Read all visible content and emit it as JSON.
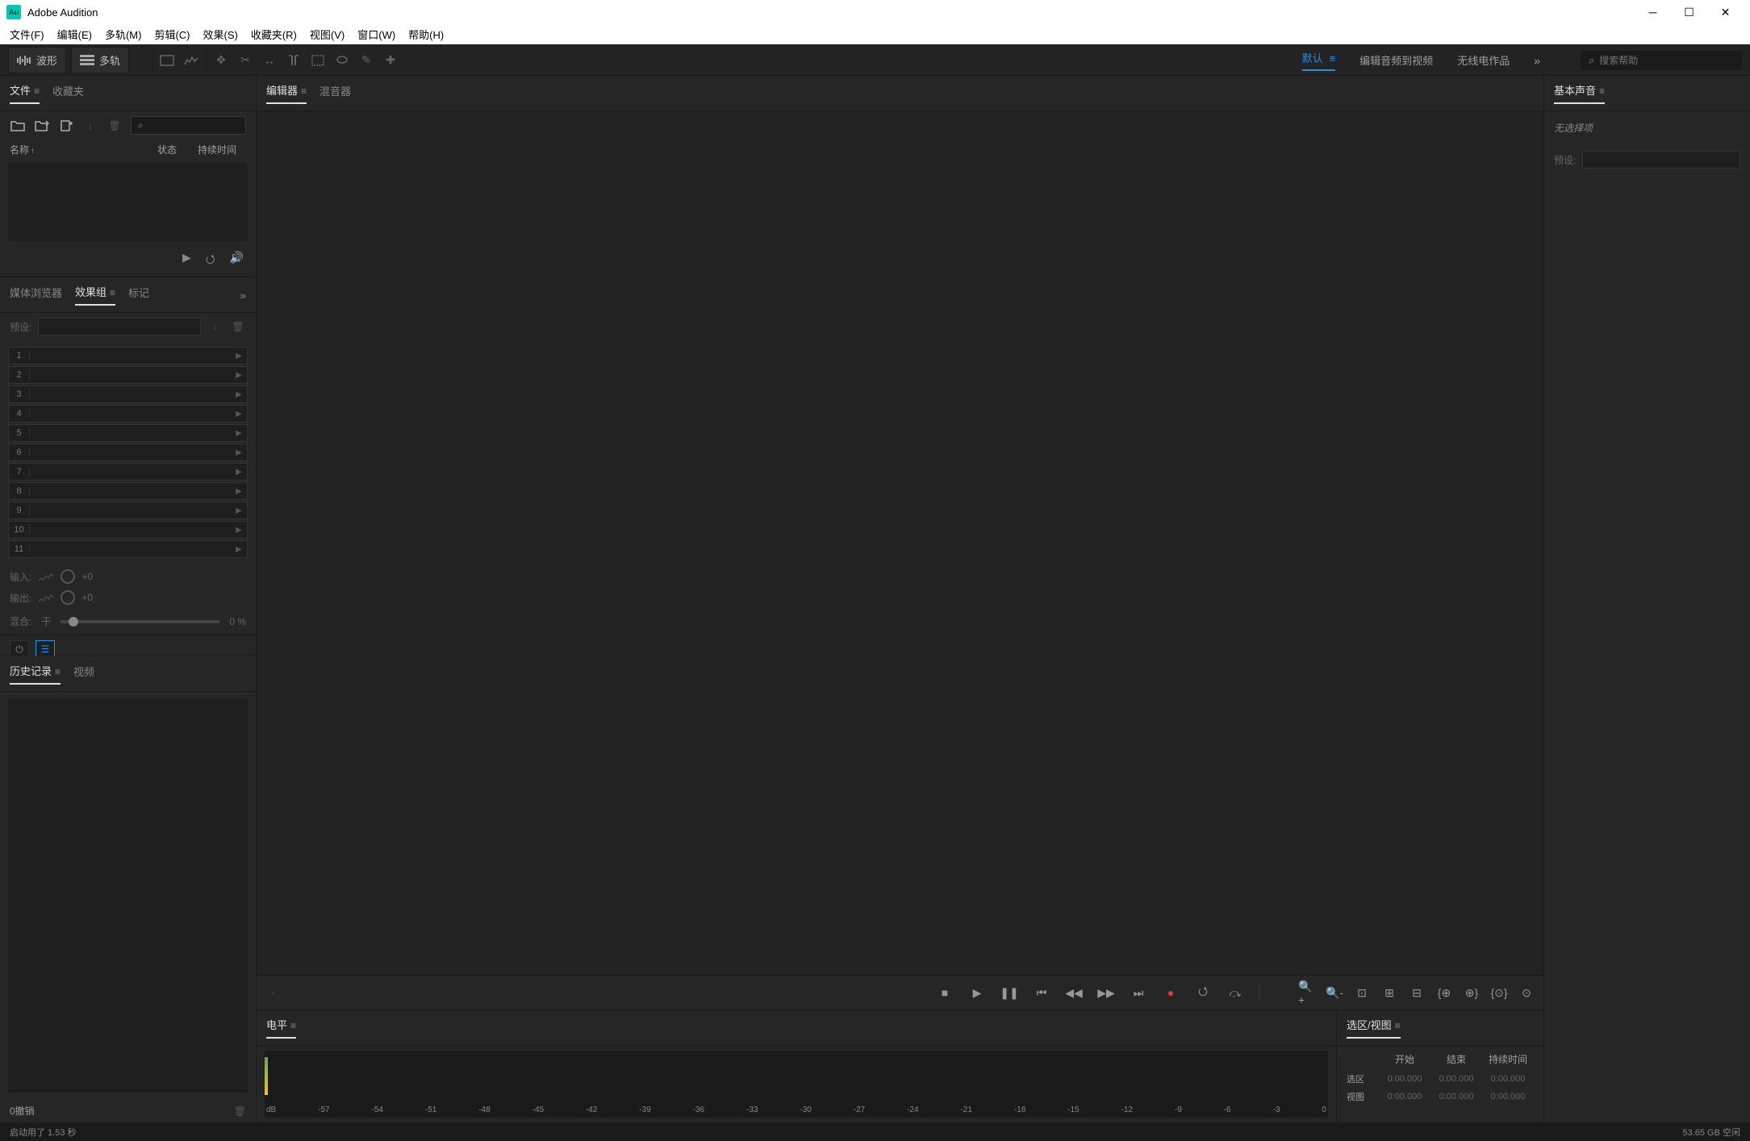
{
  "titlebar": {
    "app_name": "Adobe Audition",
    "app_icon_text": "Au"
  },
  "menubar": {
    "items": [
      "文件(F)",
      "编辑(E)",
      "多轨(M)",
      "剪辑(C)",
      "效果(S)",
      "收藏夹(R)",
      "视图(V)",
      "窗口(W)",
      "帮助(H)"
    ]
  },
  "modebar": {
    "waveform": "波形",
    "multitrack": "多轨",
    "workspaces": {
      "default": "默认",
      "edit_audio_to_video": "编辑音频到视频",
      "radio_production": "无线电作品"
    },
    "search_placeholder": "搜索帮助"
  },
  "files_panel": {
    "tab_files": "文件",
    "tab_favorites": "收藏夹",
    "col_name": "名称",
    "col_status": "状态",
    "col_duration": "持续时间"
  },
  "effects_panel": {
    "tab_media_browser": "媒体浏览器",
    "tab_effects_rack": "效果组",
    "tab_markers": "标记",
    "preset_label": "预设:",
    "slot_numbers": [
      "1",
      "2",
      "3",
      "4",
      "5",
      "6",
      "7",
      "8",
      "9",
      "10",
      "11"
    ],
    "input_label": "输入:",
    "output_label": "输出:",
    "io_value": "+0",
    "mix_label": "混合:",
    "mix_dry": "干",
    "mix_percent": "0 %"
  },
  "history_panel": {
    "tab_history": "历史记录",
    "tab_video": "视频",
    "undo_count": "0撤销"
  },
  "editor_panel": {
    "tab_editor": "编辑器",
    "tab_mixer": "混音器"
  },
  "levels_panel": {
    "tab_levels": "电平",
    "db_label": "dB",
    "db_ticks": [
      "-57",
      "-54",
      "-51",
      "-48",
      "-45",
      "-42",
      "-39",
      "-36",
      "-33",
      "-30",
      "-27",
      "-24",
      "-21",
      "-18",
      "-15",
      "-12",
      "-9",
      "-6",
      "-3",
      "0"
    ]
  },
  "selection_panel": {
    "tab": "选区/视图",
    "col_start": "开始",
    "col_end": "结束",
    "col_duration": "持续时间",
    "row_selection": "选区",
    "row_view": "视图",
    "time_zero": "0:00.000"
  },
  "essential_panel": {
    "tab": "基本声音",
    "no_selection": "无选择项",
    "preset_label": "预设:"
  },
  "statusbar": {
    "startup_time": "启动用了 1.53 秒",
    "disk_free": "53.65 GB 空闲"
  }
}
